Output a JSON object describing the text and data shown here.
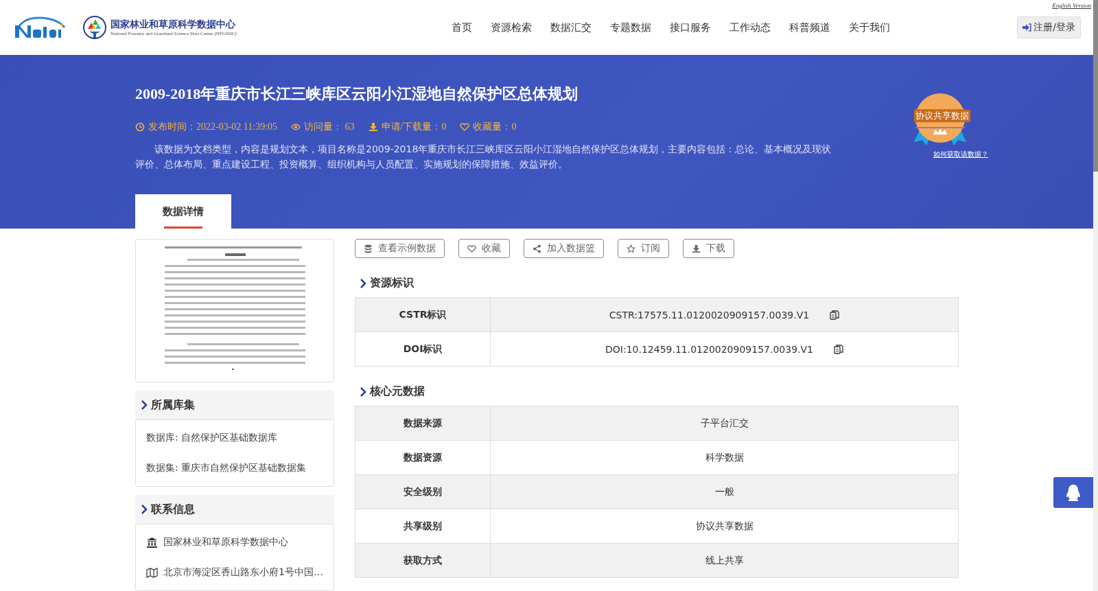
{
  "header": {
    "site_name": "国家林业和草原科学数据中心",
    "site_subtitle": "National Forestry and Grassland Science Data Center (NFGSDC)",
    "english_link": "English Version",
    "nav": [
      {
        "label": "首页"
      },
      {
        "label": "资源检索"
      },
      {
        "label": "数据汇交"
      },
      {
        "label": "专题数据"
      },
      {
        "label": "接口服务"
      },
      {
        "label": "工作动态"
      },
      {
        "label": "科普频道"
      },
      {
        "label": "关于我们"
      }
    ],
    "login_button": "注册/登录"
  },
  "banner": {
    "title": "2009-2018年重庆市长江三峡库区云阳小江湿地自然保护区总体规划",
    "meta": [
      {
        "kind": "time",
        "label": "发布时间：2022-03-02 11:39:05"
      },
      {
        "kind": "views",
        "label": "访问量： 63"
      },
      {
        "kind": "downloads",
        "label": "申请/下载量：0"
      },
      {
        "kind": "favorites",
        "label": "收藏量：0"
      }
    ],
    "description": "该数据为文档类型，内容是规划文本，项目名称是2009-2018年重庆市长江三峡库区云阳小江湿地自然保护区总体规划，主要内容包括：总论、基本概况及现状评价、总体布局、重点建设工程、投资概算、组织机构与人员配置、实施规划的保障措施、效益评价。",
    "badge": {
      "text": "协议共享数据",
      "link": "如何获取该数据？"
    },
    "tabs": [
      {
        "label": "数据详情",
        "selected": true
      }
    ]
  },
  "sidebar": {
    "collection": {
      "title": "所属库集",
      "items": [
        "数据库: 自然保护区基础数据库",
        "数据集: 重庆市自然保护区基础数据集"
      ]
    },
    "contact": {
      "title": "联系信息",
      "items": [
        {
          "kind": "org",
          "text": "国家林业和草原科学数据中心"
        },
        {
          "kind": "address",
          "text": "北京市海淀区香山路东小府1号中国…"
        }
      ]
    }
  },
  "actions": [
    {
      "kind": "sample",
      "label": "查看示例数据"
    },
    {
      "kind": "favorite",
      "label": "收藏"
    },
    {
      "kind": "basket",
      "label": "加入数据篮"
    },
    {
      "kind": "subscribe",
      "label": "订阅"
    },
    {
      "kind": "download",
      "label": "下载"
    }
  ],
  "resource_id": {
    "title": "资源标识",
    "rows": [
      {
        "label": "CSTR标识",
        "value": "CSTR:17575.11.0120020909157.0039.V1",
        "copyable": true
      },
      {
        "label": "DOI标识",
        "value": "DOI:10.12459.11.0120020909157.0039.V1",
        "copyable": true
      }
    ]
  },
  "core_metadata": {
    "title": "核心元数据",
    "rows": [
      {
        "label": "数据来源",
        "value": "子平台汇交"
      },
      {
        "label": "数据资源",
        "value": "科学数据"
      },
      {
        "label": "安全级别",
        "value": "一般"
      },
      {
        "label": "共享级别",
        "value": "协议共享数据"
      },
      {
        "label": "获取方式",
        "value": "线上共享"
      }
    ]
  }
}
